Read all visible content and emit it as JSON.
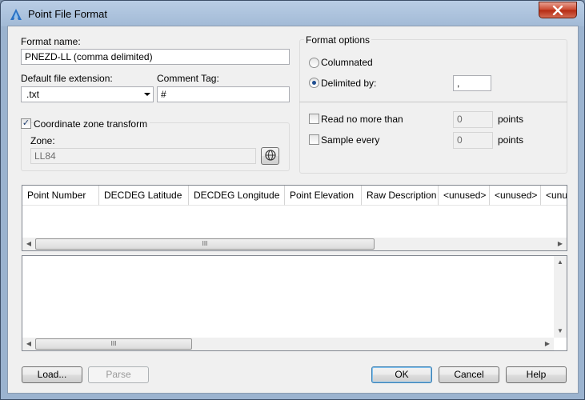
{
  "window": {
    "title": "Point File Format"
  },
  "format_name": {
    "label": "Format name:",
    "value": "PNEZD-LL (comma delimited)"
  },
  "file_extension": {
    "label": "Default file extension:",
    "value": ".txt"
  },
  "comment_tag": {
    "label": "Comment Tag:",
    "value": "#"
  },
  "coordinate_zone": {
    "label": "Coordinate zone transform",
    "checked": true,
    "zone_label": "Zone:",
    "zone_value": "LL84"
  },
  "format_options": {
    "title": "Format options",
    "columnated_label": "Columnated",
    "delimited_label": "Delimited by:",
    "delimiter_value": ",",
    "selected": "delimited"
  },
  "limits": {
    "read_label": "Read no more than",
    "read_value": "0",
    "read_unit": "points",
    "sample_label": "Sample every",
    "sample_value": "0",
    "sample_unit": "points"
  },
  "columns": [
    "Point Number",
    "DECDEG Latitude",
    "DECDEG Longitude",
    "Point Elevation",
    "Raw Description",
    "<unused>",
    "<unused>",
    "<unu"
  ],
  "scrollbar": {
    "grip": "III"
  },
  "buttons": {
    "load": "Load...",
    "parse": "Parse",
    "ok": "OK",
    "cancel": "Cancel",
    "help": "Help"
  },
  "icons": {
    "app": "autodesk-civil-icon",
    "close": "close-x-icon",
    "globe": "globe-icon",
    "dropdown": "dropdown-arrow-icon"
  },
  "colors": {
    "title_gradient_top": "#b9cde5",
    "close_red": "#c9462c",
    "default_button_border": "#3c7fb1"
  }
}
